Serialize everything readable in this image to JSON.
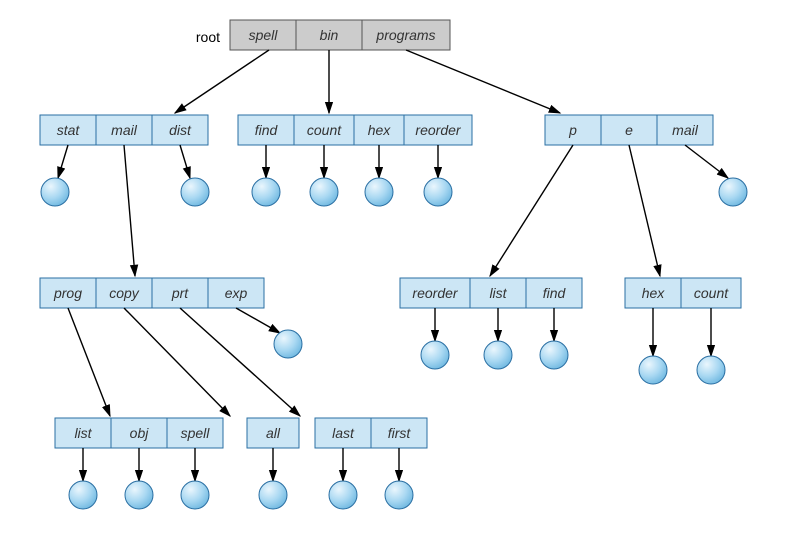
{
  "root_label": "root",
  "nodes": {
    "root": {
      "cells": [
        "spell",
        "bin",
        "programs"
      ],
      "root": true
    },
    "n_smd": {
      "cells": [
        "stat",
        "mail",
        "dist"
      ]
    },
    "n_fchr": {
      "cells": [
        "find",
        "count",
        "hex",
        "reorder"
      ]
    },
    "n_pem": {
      "cells": [
        "p",
        "e",
        "mail"
      ]
    },
    "n_pcpe": {
      "cells": [
        "prog",
        "copy",
        "prt",
        "exp"
      ]
    },
    "n_rlf": {
      "cells": [
        "reorder",
        "list",
        "find"
      ]
    },
    "n_hc": {
      "cells": [
        "hex",
        "count"
      ]
    },
    "n_los": {
      "cells": [
        "list",
        "obj",
        "spell"
      ]
    },
    "n_all": {
      "cells": [
        "all"
      ]
    },
    "n_lf": {
      "cells": [
        "last",
        "first"
      ]
    }
  }
}
